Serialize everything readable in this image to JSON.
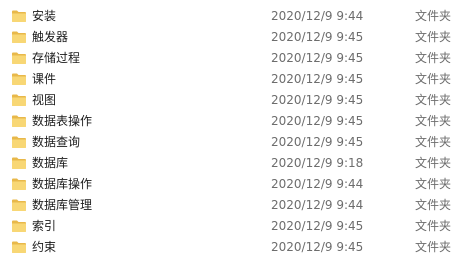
{
  "files": [
    {
      "name": "安装",
      "date": "2020/12/9 9:44",
      "type": "文件夹",
      "icon": "folder-icon"
    },
    {
      "name": "触发器",
      "date": "2020/12/9 9:45",
      "type": "文件夹",
      "icon": "folder-icon"
    },
    {
      "name": "存储过程",
      "date": "2020/12/9 9:45",
      "type": "文件夹",
      "icon": "folder-icon"
    },
    {
      "name": "课件",
      "date": "2020/12/9 9:45",
      "type": "文件夹",
      "icon": "folder-icon"
    },
    {
      "name": "视图",
      "date": "2020/12/9 9:45",
      "type": "文件夹",
      "icon": "folder-icon"
    },
    {
      "name": "数据表操作",
      "date": "2020/12/9 9:45",
      "type": "文件夹",
      "icon": "folder-icon"
    },
    {
      "name": "数据查询",
      "date": "2020/12/9 9:45",
      "type": "文件夹",
      "icon": "folder-icon"
    },
    {
      "name": "数据库",
      "date": "2020/12/9 9:18",
      "type": "文件夹",
      "icon": "folder-icon"
    },
    {
      "name": "数据库操作",
      "date": "2020/12/9 9:44",
      "type": "文件夹",
      "icon": "folder-icon"
    },
    {
      "name": "数据库管理",
      "date": "2020/12/9 9:44",
      "type": "文件夹",
      "icon": "folder-icon"
    },
    {
      "name": "索引",
      "date": "2020/12/9 9:45",
      "type": "文件夹",
      "icon": "folder-icon"
    },
    {
      "name": "约束",
      "date": "2020/12/9 9:45",
      "type": "文件夹",
      "icon": "folder-icon"
    }
  ],
  "colors": {
    "folder_body": "#F8D775",
    "folder_tab": "#E8B84A",
    "text": "#1a1a1a",
    "secondary_text": "#6d6d6d"
  }
}
